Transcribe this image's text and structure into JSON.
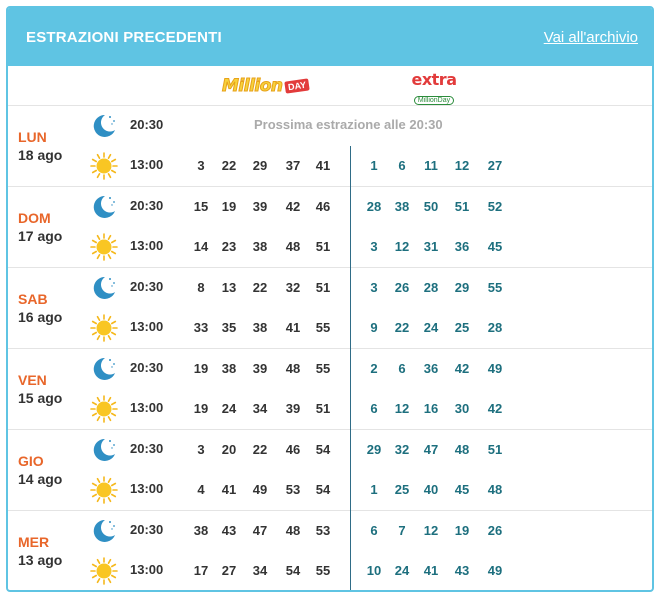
{
  "header": {
    "title": "ESTRAZIONI PRECEDENTI",
    "archive_link": "Vai all'archivio"
  },
  "logos": {
    "millionday_text": "Million",
    "millionday_badge": "DAY",
    "extra_text": "extra",
    "extra_sub": "MillionDay"
  },
  "icons": {
    "evening": "moon-icon",
    "midday": "sun-icon"
  },
  "colors": {
    "accent": "#5fc4e3",
    "day": "#e8662a",
    "extra": "#1d6f7e"
  },
  "days": [
    {
      "name": "LUN",
      "date": "18 ago",
      "draws": [
        {
          "time": "20:30",
          "pending": "Prossima estrazione alle 20:30",
          "main": [],
          "extra": []
        },
        {
          "time": "13:00",
          "main": [
            "3",
            "22",
            "29",
            "37",
            "41"
          ],
          "extra": [
            "1",
            "6",
            "11",
            "12",
            "27"
          ]
        }
      ]
    },
    {
      "name": "DOM",
      "date": "17 ago",
      "draws": [
        {
          "time": "20:30",
          "main": [
            "15",
            "19",
            "39",
            "42",
            "46"
          ],
          "extra": [
            "28",
            "38",
            "50",
            "51",
            "52"
          ]
        },
        {
          "time": "13:00",
          "main": [
            "14",
            "23",
            "38",
            "48",
            "51"
          ],
          "extra": [
            "3",
            "12",
            "31",
            "36",
            "45"
          ]
        }
      ]
    },
    {
      "name": "SAB",
      "date": "16 ago",
      "draws": [
        {
          "time": "20:30",
          "main": [
            "8",
            "13",
            "22",
            "32",
            "51"
          ],
          "extra": [
            "3",
            "26",
            "28",
            "29",
            "55"
          ]
        },
        {
          "time": "13:00",
          "main": [
            "33",
            "35",
            "38",
            "41",
            "55"
          ],
          "extra": [
            "9",
            "22",
            "24",
            "25",
            "28"
          ]
        }
      ]
    },
    {
      "name": "VEN",
      "date": "15 ago",
      "draws": [
        {
          "time": "20:30",
          "main": [
            "19",
            "38",
            "39",
            "48",
            "55"
          ],
          "extra": [
            "2",
            "6",
            "36",
            "42",
            "49"
          ]
        },
        {
          "time": "13:00",
          "main": [
            "19",
            "24",
            "34",
            "39",
            "51"
          ],
          "extra": [
            "6",
            "12",
            "16",
            "30",
            "42"
          ]
        }
      ]
    },
    {
      "name": "GIO",
      "date": "14 ago",
      "draws": [
        {
          "time": "20:30",
          "main": [
            "3",
            "20",
            "22",
            "46",
            "54"
          ],
          "extra": [
            "29",
            "32",
            "47",
            "48",
            "51"
          ]
        },
        {
          "time": "13:00",
          "main": [
            "4",
            "41",
            "49",
            "53",
            "54"
          ],
          "extra": [
            "1",
            "25",
            "40",
            "45",
            "48"
          ]
        }
      ]
    },
    {
      "name": "MER",
      "date": "13 ago",
      "draws": [
        {
          "time": "20:30",
          "main": [
            "38",
            "43",
            "47",
            "48",
            "53"
          ],
          "extra": [
            "6",
            "7",
            "12",
            "19",
            "26"
          ]
        },
        {
          "time": "13:00",
          "main": [
            "17",
            "27",
            "34",
            "54",
            "55"
          ],
          "extra": [
            "10",
            "24",
            "41",
            "43",
            "49"
          ]
        }
      ]
    }
  ]
}
